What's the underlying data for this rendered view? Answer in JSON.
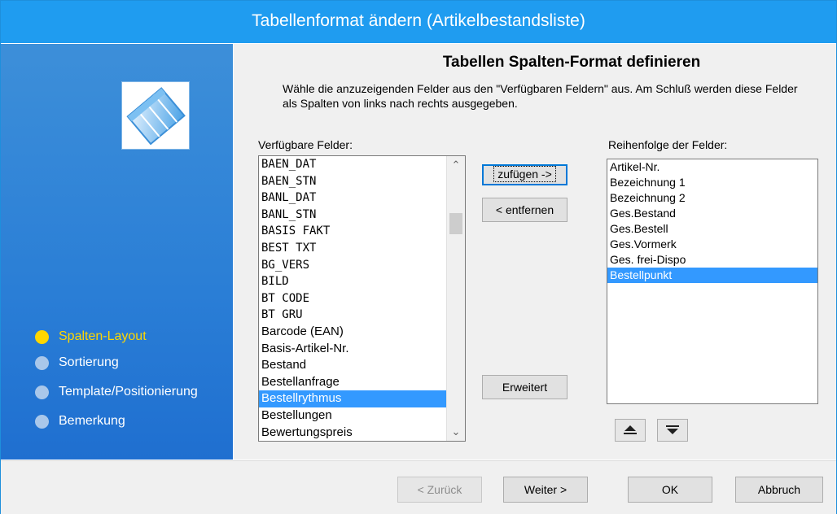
{
  "window": {
    "title": "Tabellenformat ändern (Artikelbestandsliste)"
  },
  "sidebar": {
    "steps": [
      {
        "label": "Spalten-Layout",
        "active": true
      },
      {
        "label": "Sortierung",
        "active": false
      },
      {
        "label": "Template/Positionierung",
        "active": false
      },
      {
        "label": "Bemerkung",
        "active": false
      }
    ]
  },
  "main": {
    "heading": "Tabellen Spalten-Format definieren",
    "description": "Wähle die anzuzeigenden Felder aus den \"Verfügbaren Feldern\" aus. Am Schluß werden diese Felder als Spalten von links nach rechts ausgegeben.",
    "available_label": "Verfügbare Felder:",
    "order_label": "Reihenfolge der Felder:",
    "available_fields": [
      "BAEN_DAT",
      "BAEN_STN",
      "BANL_DAT",
      "BANL_STN",
      "BASIS FAKT",
      "BEST TXT",
      "BG_VERS",
      "BILD",
      "BT CODE",
      "BT GRU",
      "Barcode (EAN)",
      "Basis-Artikel-Nr.",
      "Bestand",
      "Bestellanfrage",
      "Bestellrythmus",
      "Bestellungen",
      "Bewertungspreis"
    ],
    "available_selected": "Bestellrythmus",
    "ordered_fields": [
      "Artikel-Nr.",
      "Bezeichnung 1",
      "Bezeichnung 2",
      "Ges.Bestand",
      "Ges.Bestell",
      "Ges.Vormerk",
      "Ges. frei-Dispo",
      "Bestellpunkt"
    ],
    "ordered_selected": "Bestellpunkt",
    "buttons": {
      "add": "zufügen ->",
      "remove": "< entfernen",
      "extended": "Erweitert"
    },
    "move_up_icon": "move-up-icon",
    "move_down_icon": "move-down-icon"
  },
  "footer": {
    "back": "< Zurück",
    "next": "Weiter >",
    "ok": "OK",
    "cancel": "Abbruch"
  },
  "colors": {
    "title_bar": "#1f9cf0",
    "sidebar": "#2a7ed6",
    "active_step": "#ffd700",
    "selection": "#3399ff"
  }
}
